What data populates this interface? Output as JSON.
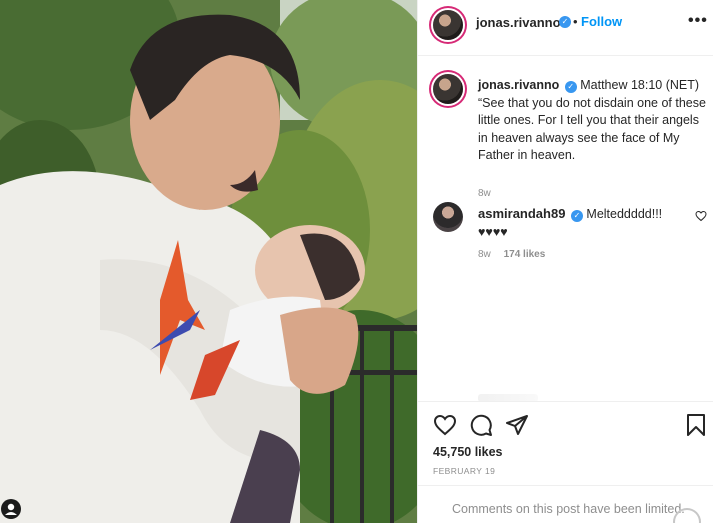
{
  "post": {
    "username": "jonas.rivanno",
    "follow_label": "Follow",
    "separator": "•",
    "more_label": "•••"
  },
  "caption": {
    "username": "jonas.rivanno",
    "text": "Matthew 18:10 (NET) “See that you do not disdain one of these little ones. For I tell you that their angels in heaven always see the face of My Father in heaven.",
    "time": "8w"
  },
  "comment": {
    "username": "asmirandah89",
    "text": "Melteddddd!!! ♥♥♥♥",
    "time": "8w",
    "likes": "174 likes"
  },
  "stats": {
    "likes": "45,750 likes",
    "date": "FEBRUARY 19"
  },
  "footer": {
    "limited": "Comments on this post have been limited."
  },
  "icons": {
    "verified": "verified-badge-icon",
    "like": "heart-icon",
    "comment": "comment-icon",
    "share": "paper-plane-icon",
    "save": "bookmark-icon"
  },
  "colors": {
    "follow": "#0095f6",
    "verified": "#3897f0",
    "muted": "#8e8e8e",
    "text": "#262626"
  }
}
